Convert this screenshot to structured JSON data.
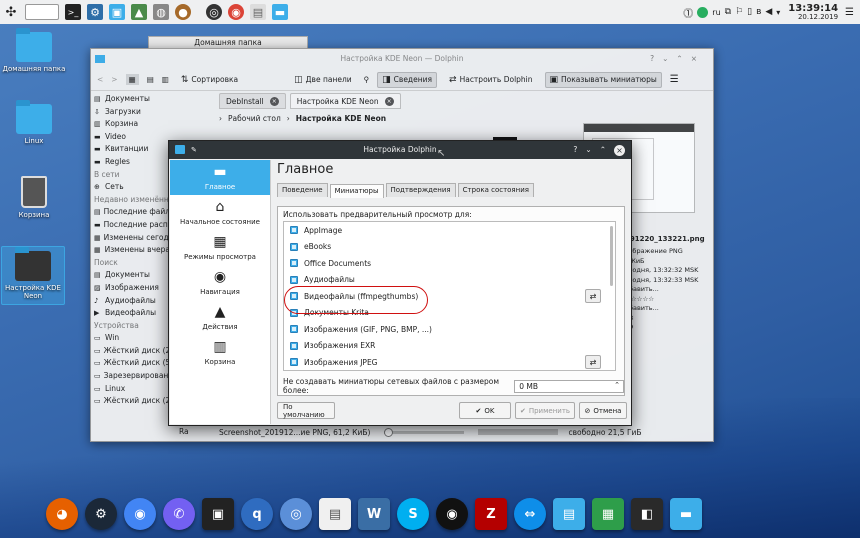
{
  "top_panel": {
    "tray_text": "ru",
    "time": "13:39:14",
    "date": "20.12.2019"
  },
  "desktop_icons": [
    {
      "label": "Домашняя папка"
    },
    {
      "label": "Linux"
    },
    {
      "label": "Корзина"
    },
    {
      "label": "Настройка KDE Neon"
    }
  ],
  "tooltip": "Домашняя папка",
  "dolphin": {
    "title": "Настройка KDE Neon — Dolphin",
    "toolbar": {
      "sort": "Сортировка",
      "two_panels": "Две панели",
      "info": "Сведения",
      "configure": "Настроить Dolphin",
      "thumbnails": "Показывать миниатюры"
    },
    "tabs": [
      "DebInstall",
      "Настройка KDE Neon"
    ],
    "breadcrumb": [
      "Рабочий стол",
      "Настройка KDE Neon"
    ],
    "places": [
      {
        "label": "Документы",
        "icon": "document-icon",
        "head": false
      },
      {
        "label": "Загрузки",
        "icon": "download-icon",
        "head": false
      },
      {
        "label": "Корзина",
        "icon": "trash-icon",
        "head": false
      },
      {
        "label": "Video",
        "icon": "folder-icon",
        "head": false
      },
      {
        "label": "Квитанции",
        "icon": "folder-icon",
        "head": false
      },
      {
        "label": "Regles",
        "icon": "folder-icon",
        "head": false
      },
      {
        "label": "В сети",
        "icon": "",
        "head": true
      },
      {
        "label": "Сеть",
        "icon": "network-icon",
        "head": false
      },
      {
        "label": "Недавно изменённые",
        "icon": "",
        "head": true
      },
      {
        "label": "Последние файлы",
        "icon": "document-icon",
        "head": false
      },
      {
        "label": "Последние распол",
        "icon": "folder-icon",
        "head": false
      },
      {
        "label": "Изменены сегодн",
        "icon": "calendar-icon",
        "head": false
      },
      {
        "label": "Изменены вчера",
        "icon": "calendar-icon",
        "head": false
      },
      {
        "label": "Поиск",
        "icon": "",
        "head": true
      },
      {
        "label": "Документы",
        "icon": "document-icon",
        "head": false
      },
      {
        "label": "Изображения",
        "icon": "image-icon",
        "head": false
      },
      {
        "label": "Аудиофайлы",
        "icon": "audio-icon",
        "head": false
      },
      {
        "label": "Видеофайлы",
        "icon": "video-icon",
        "head": false
      },
      {
        "label": "Устройства",
        "icon": "",
        "head": true
      },
      {
        "label": "Win",
        "icon": "drive-icon",
        "head": false
      },
      {
        "label": "Жёсткий диск (27,",
        "icon": "drive-icon",
        "head": false
      },
      {
        "label": "Жёсткий диск (54,",
        "icon": "drive-icon",
        "head": false
      },
      {
        "label": "Зарезервировано",
        "icon": "drive-icon",
        "head": false
      },
      {
        "label": "Linux",
        "icon": "drive-icon",
        "head": false
      },
      {
        "label": "Жёсткий диск (28,",
        "icon": "drive-icon",
        "head": false
      }
    ],
    "partial_labels": {
      "t1": "Te",
      "t2": "Ra"
    },
    "info_panel": {
      "filename": "191220_133221.png",
      "lines": [
        "зображение PNG",
        "2 КиБ",
        "егодня, 13:32:32 MSK",
        "егодня, 13:32:33 MSK",
        "обавить...",
        "☆☆☆☆☆",
        "обавить...",
        "98",
        "49"
      ]
    },
    "status": {
      "file": "Screenshot_201912...ие PNG, 61,2 КиБ)",
      "free": "свободно 21,5 ГиБ"
    }
  },
  "dialog": {
    "title": "Настройка Dolphin",
    "heading": "Главное",
    "sidebar": [
      {
        "label": "Главное",
        "icon": "folder-icon",
        "selected": true
      },
      {
        "label": "Начальное состояние",
        "icon": "home-icon",
        "selected": false
      },
      {
        "label": "Режимы просмотра",
        "icon": "view-modes-icon",
        "selected": false
      },
      {
        "label": "Навигация",
        "icon": "compass-icon",
        "selected": false
      },
      {
        "label": "Действия",
        "icon": "actions-icon",
        "selected": false
      },
      {
        "label": "Корзина",
        "icon": "trash-icon",
        "selected": false
      }
    ],
    "tabs": [
      "Поведение",
      "Миниатюры",
      "Подтверждения",
      "Строка состояния"
    ],
    "active_tab": 1,
    "preview_label": "Использовать предварительный просмотр для:",
    "items": [
      {
        "label": "AppImage",
        "configurable": false
      },
      {
        "label": "eBooks",
        "configurable": false
      },
      {
        "label": "Office Documents",
        "configurable": false
      },
      {
        "label": "Аудиофайлы",
        "configurable": false
      },
      {
        "label": "Видеофайлы (ffmpegthumbs)",
        "configurable": true
      },
      {
        "label": "Документы Krita",
        "configurable": false
      },
      {
        "label": "Изображения (GIF, PNG, BMP, ...)",
        "configurable": false
      },
      {
        "label": "Изображения EXR",
        "configurable": false
      },
      {
        "label": "Изображения JPEG",
        "configurable": true
      }
    ],
    "size_label": "Не создавать миниатюры сетевых файлов с размером более:",
    "size_value": "0 МВ",
    "buttons": {
      "defaults": "По умолчанию",
      "ok": "OK",
      "apply": "Применить",
      "cancel": "Отмена"
    }
  },
  "dock": [
    {
      "name": "firefox-icon",
      "color": "#e66000"
    },
    {
      "name": "steam-icon",
      "color": "#1b2838"
    },
    {
      "name": "chrome-icon",
      "color": "#4285f4"
    },
    {
      "name": "viber-icon",
      "color": "#7360f2"
    },
    {
      "name": "radio-icon",
      "color": "#222222"
    },
    {
      "name": "qbittorrent-icon",
      "color": "#2f6cc0"
    },
    {
      "name": "chromium-icon",
      "color": "#5b8fd8"
    },
    {
      "name": "document-viewer-icon",
      "color": "#f0f0f0"
    },
    {
      "name": "monitor-app-icon",
      "color": "#3a6ea5"
    },
    {
      "name": "skype-icon",
      "color": "#00aff0"
    },
    {
      "name": "webcam-icon",
      "color": "#111111"
    },
    {
      "name": "filezilla-icon",
      "color": "#b40000"
    },
    {
      "name": "teamviewer-icon",
      "color": "#0e8ee9"
    },
    {
      "name": "text-document-icon",
      "color": "#3daee9"
    },
    {
      "name": "spreadsheet-icon",
      "color": "#2e9e4a"
    },
    {
      "name": "kde-connect-icon",
      "color": "#2a2a2a"
    },
    {
      "name": "file-manager-icon",
      "color": "#3daee9"
    }
  ]
}
